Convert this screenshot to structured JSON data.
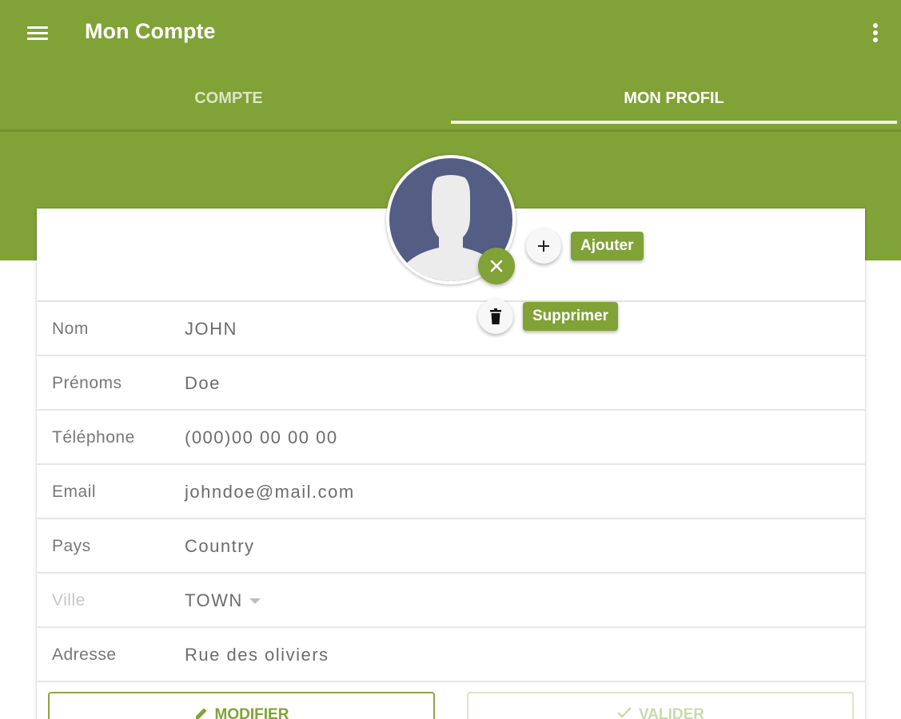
{
  "appbar": {
    "title": "Mon Compte",
    "menu_icon": "hamburger-menu-icon",
    "more_icon": "more-vert-icon",
    "background_color": "#80a236"
  },
  "tabs": [
    {
      "label": "COMPTE",
      "active": false
    },
    {
      "label": "MON PROFIL",
      "active": true
    }
  ],
  "avatar": {
    "icon": "person-silhouette-icon"
  },
  "fab_menu": {
    "close_icon": "close-icon",
    "add": {
      "icon": "plus-icon",
      "label": "Ajouter"
    },
    "delete": {
      "icon": "trash-icon",
      "label": "Supprimer"
    }
  },
  "profile_fields": [
    {
      "label": "Nom",
      "value": "JOHN"
    },
    {
      "label": "Prénoms",
      "value": "Doe"
    },
    {
      "label": "Téléphone",
      "value": "(000)00 00 00 00"
    },
    {
      "label": "Email",
      "value": "johndoe@mail.com"
    },
    {
      "label": "Pays",
      "value": "Country"
    },
    {
      "label": "Ville",
      "value": "TOWN",
      "disabled": true,
      "dropdown": true
    },
    {
      "label": "Adresse",
      "value": "Rue des oliviers"
    }
  ],
  "actions": {
    "modifier": {
      "label": "MODIFIER",
      "icon": "pencil-icon"
    },
    "valider": {
      "label": "VALIDER",
      "icon": "check-icon",
      "disabled": true
    }
  }
}
